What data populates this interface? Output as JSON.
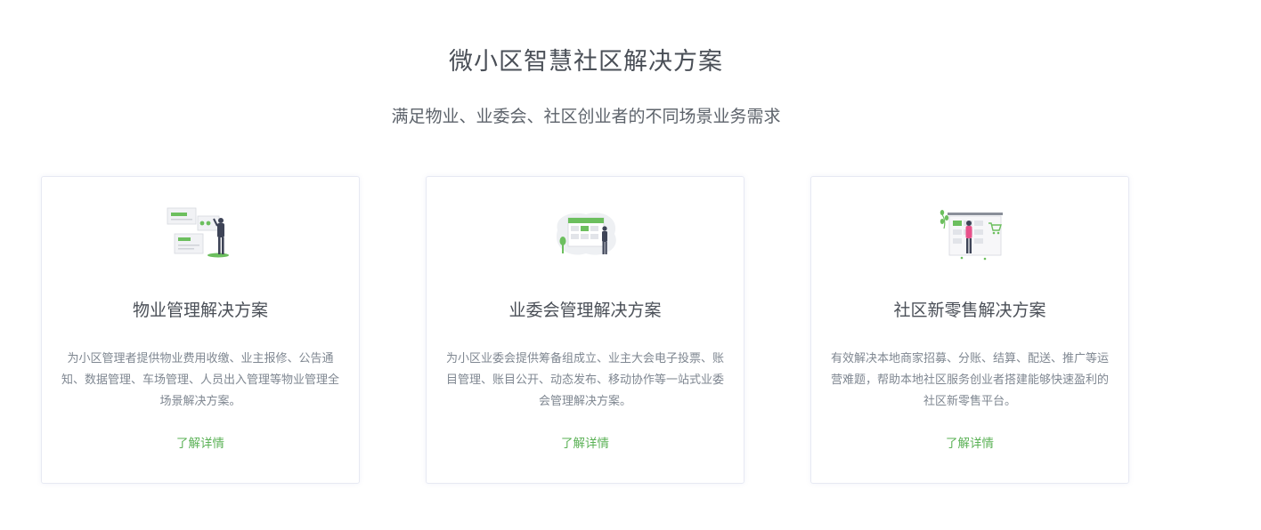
{
  "section": {
    "title": "微小区智慧社区解决方案",
    "subtitle": "满足物业、业委会、社区创业者的不同场景业务需求"
  },
  "colors": {
    "accent_green": "#5ab155",
    "figure_dark": "#3e4457",
    "figure_pink": "#e8518b",
    "panel_gray": "#e5e6ea"
  },
  "cards": [
    {
      "icon": "property-management-illustration-icon",
      "title": "物业管理解决方案",
      "description": "为小区管理者提供物业费用收缴、业主报修、公告通知、数据管理、车场管理、人员出入管理等物业管理全场景解决方案。",
      "link": "了解详情"
    },
    {
      "icon": "owners-committee-illustration-icon",
      "title": "业委会管理解决方案",
      "description": "为小区业委会提供筹备组成立、业主大会电子投票、账目管理、账目公开、动态发布、移动协作等一站式业委会管理解决方案。",
      "link": "了解详情"
    },
    {
      "icon": "community-retail-illustration-icon",
      "title": "社区新零售解决方案",
      "description": "有效解决本地商家招募、分账、结算、配送、推广等运营难题，帮助本地社区服务创业者搭建能够快速盈利的社区新零售平台。",
      "link": "了解详情"
    }
  ]
}
